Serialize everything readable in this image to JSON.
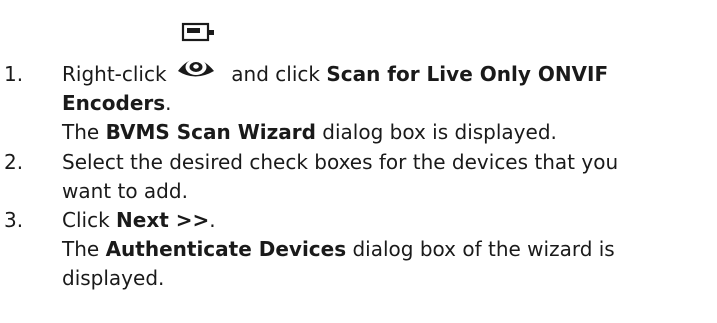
{
  "steps": [
    {
      "number": "1.",
      "line1_pre": "Right-click",
      "icon": "onvif-live-encoder-icon",
      "line1_mid": "and click",
      "line1_bold": "Scan for Live Only ONVIF",
      "line2_bold": "Encoders",
      "line2_tail": ".",
      "line3_pre": "The",
      "line3_bold": "BVMS Scan Wizard",
      "line3_post": "dialog box is displayed."
    },
    {
      "number": "2.",
      "line1": "Select the desired check boxes for the devices that you",
      "line2": "want to add."
    },
    {
      "number": "3.",
      "line1_pre": "Click",
      "line1_bold": "Next >>",
      "line1_tail": ".",
      "line2_pre": "The",
      "line2_bold": "Authenticate Devices",
      "line2_post": "dialog box of the wizard is",
      "line3": "displayed."
    }
  ],
  "colors": {
    "text": "#1a1a1a",
    "icon": "#1a1a1a"
  }
}
